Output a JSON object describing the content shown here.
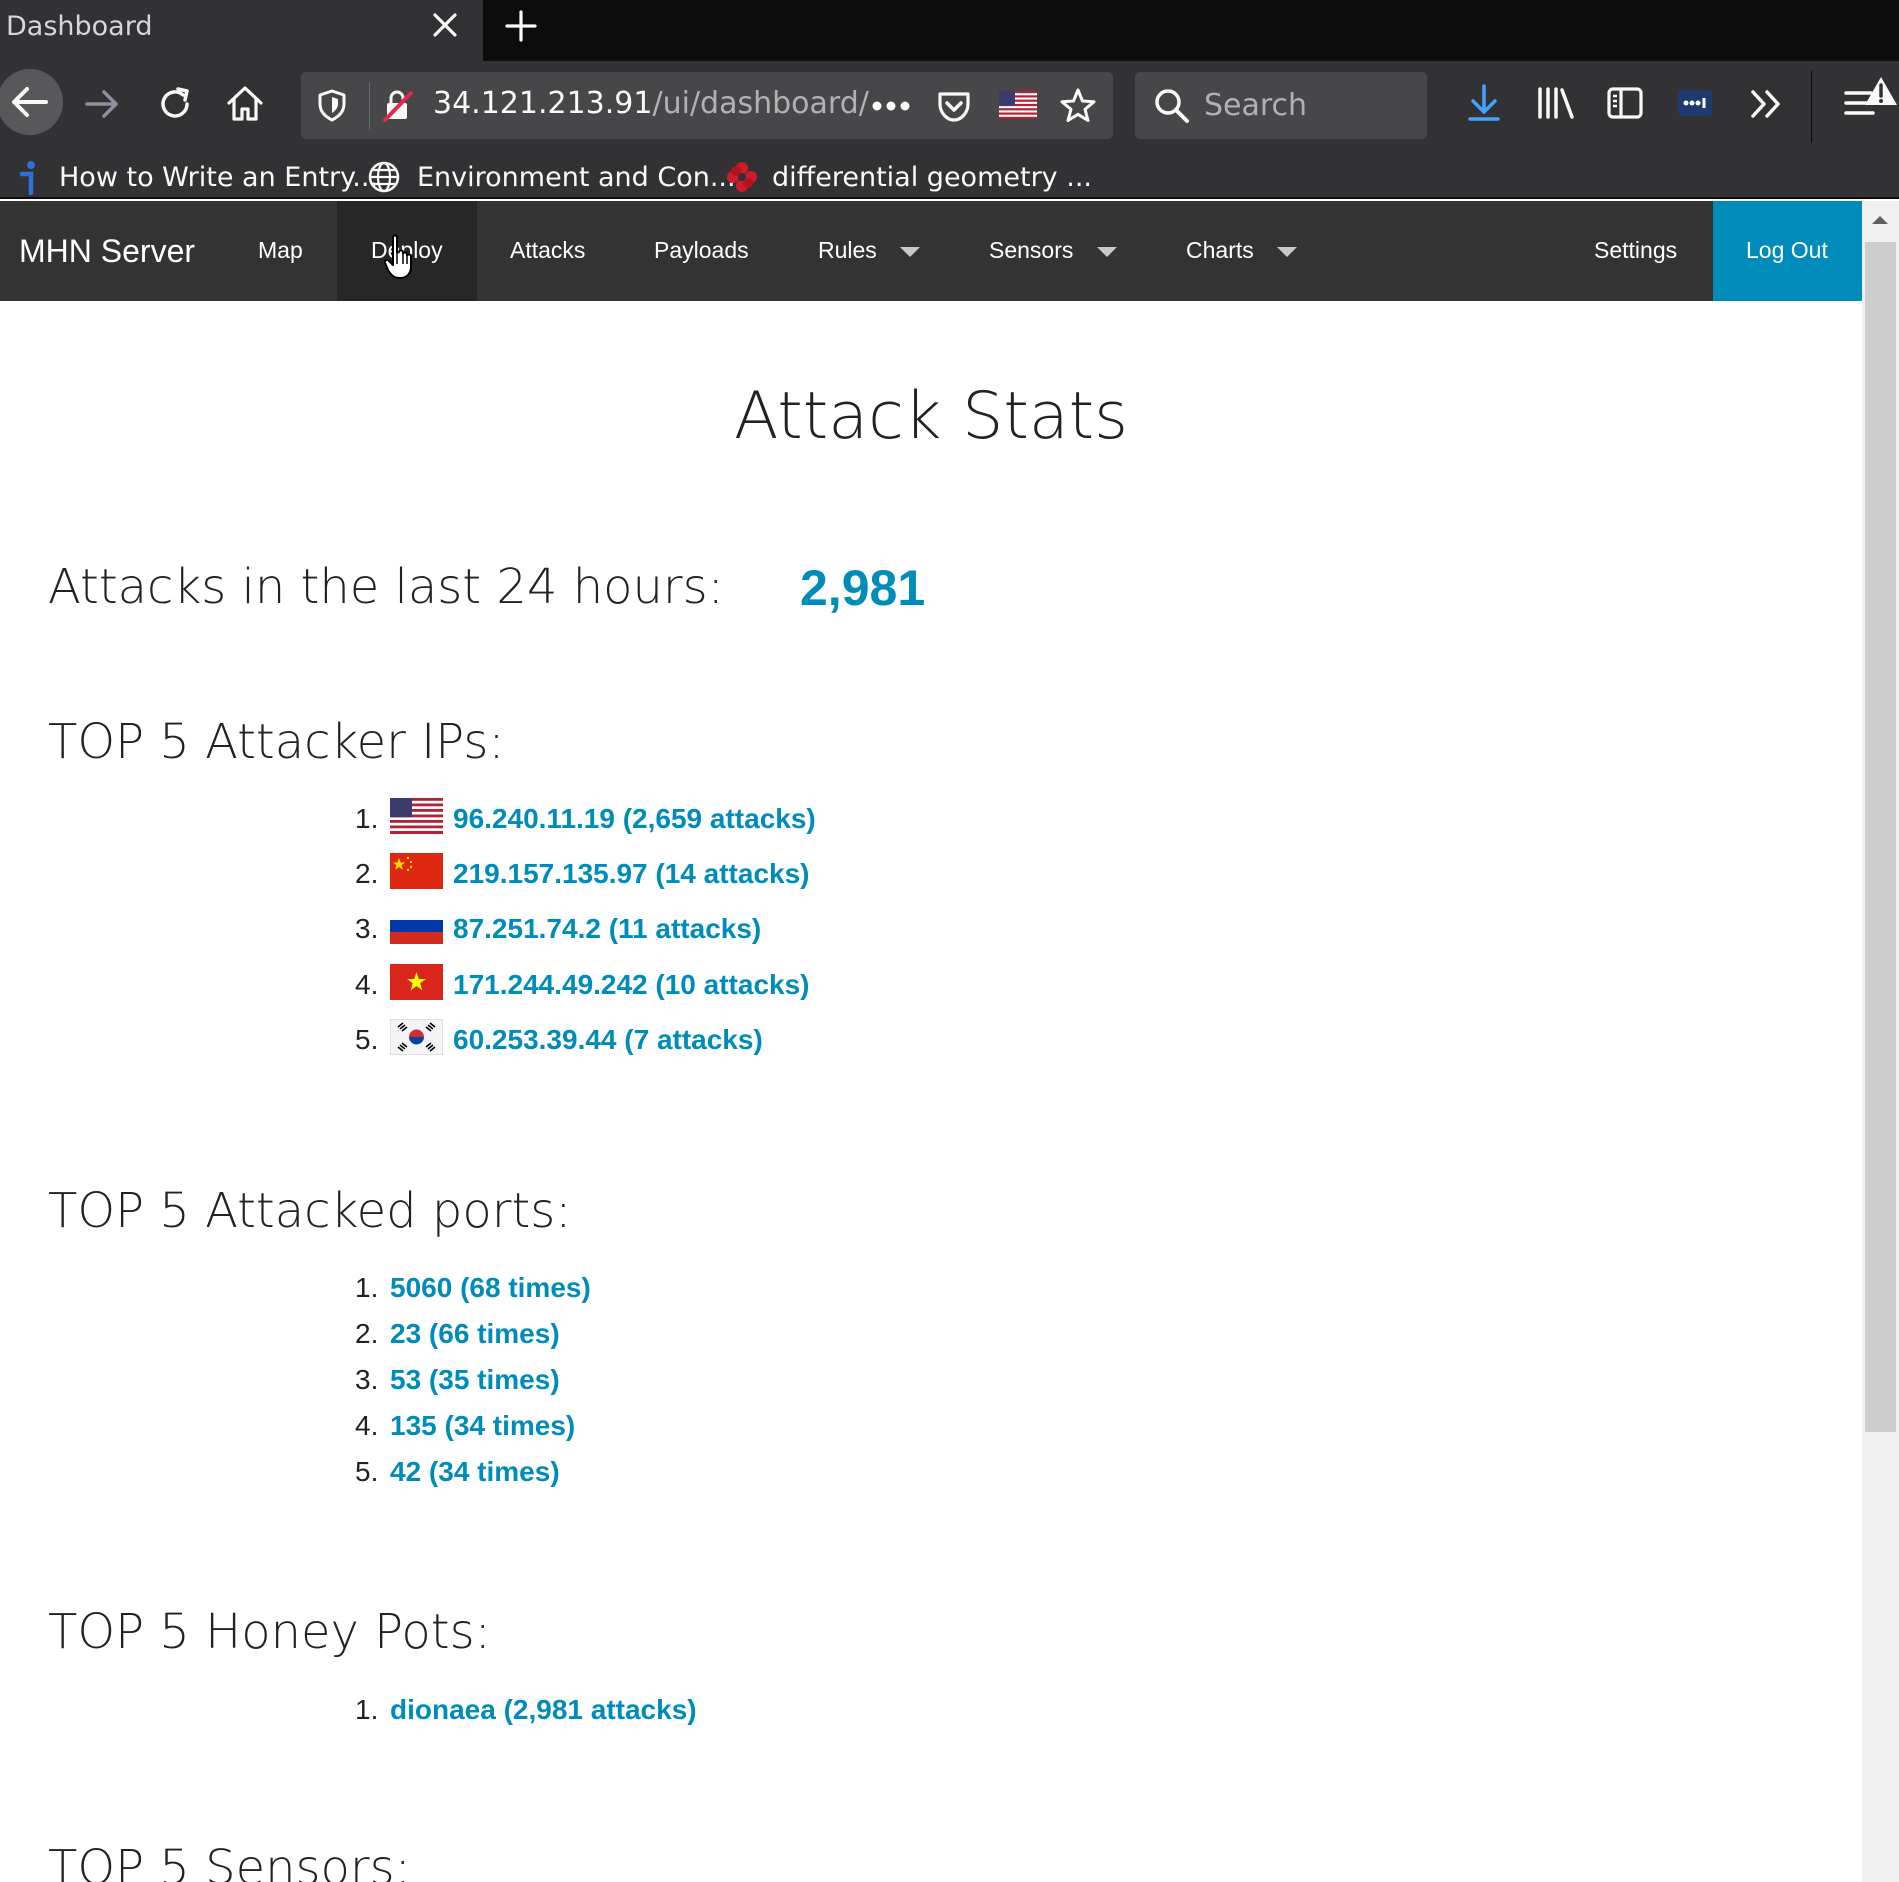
{
  "browser": {
    "tab_title": "Dashboard",
    "url_host": "34.121.213.91",
    "url_path": "/ui/dashboard/",
    "search_placeholder": "Search",
    "bookmarks": [
      {
        "label": "How to Write an Entry...",
        "icon": "info-icon"
      },
      {
        "label": "Environment and Con...",
        "icon": "globe-icon"
      },
      {
        "label": "differential geometry ...",
        "icon": "flower-icon"
      }
    ]
  },
  "nav": {
    "brand": "MHN Server",
    "items": [
      {
        "label": "Map"
      },
      {
        "label": "Deploy",
        "active": true
      },
      {
        "label": "Attacks"
      },
      {
        "label": "Payloads"
      },
      {
        "label": "Rules",
        "dropdown": true
      },
      {
        "label": "Sensors",
        "dropdown": true
      },
      {
        "label": "Charts",
        "dropdown": true
      }
    ],
    "settings": "Settings",
    "logout": "Log Out",
    "accent_color": "#008cba"
  },
  "main": {
    "title": "Attack Stats",
    "attacks_24h_label": "Attacks in the last 24 hours:",
    "attacks_24h_value": "2,981",
    "top_ips_heading": "TOP 5 Attacker IPs:",
    "top_ips": [
      {
        "num": "1.",
        "text": "96.240.11.19 (2,659 attacks)",
        "flag": "us-flag-icon"
      },
      {
        "num": "2.",
        "text": "219.157.135.97 (14 attacks)",
        "flag": "cn-flag-icon"
      },
      {
        "num": "3.",
        "text": "87.251.74.2 (11 attacks)",
        "flag": "ru-flag-icon"
      },
      {
        "num": "4.",
        "text": "171.244.49.242 (10 attacks)",
        "flag": "vn-flag-icon"
      },
      {
        "num": "5.",
        "text": "60.253.39.44 (7 attacks)",
        "flag": "kr-flag-icon"
      }
    ],
    "top_ports_heading": "TOP 5 Attacked ports:",
    "top_ports": [
      {
        "num": "1.",
        "text": "5060 (68 times)"
      },
      {
        "num": "2.",
        "text": "23 (66 times)"
      },
      {
        "num": "3.",
        "text": "53 (35 times)"
      },
      {
        "num": "4.",
        "text": "135 (34 times)"
      },
      {
        "num": "5.",
        "text": "42 (34 times)"
      }
    ],
    "top_honeypots_heading": "TOP 5 Honey Pots:",
    "top_honeypots": [
      {
        "num": "1.",
        "text": "dionaea (2,981 attacks)"
      }
    ],
    "top_sensors_heading": "TOP 5 Sensors:"
  }
}
